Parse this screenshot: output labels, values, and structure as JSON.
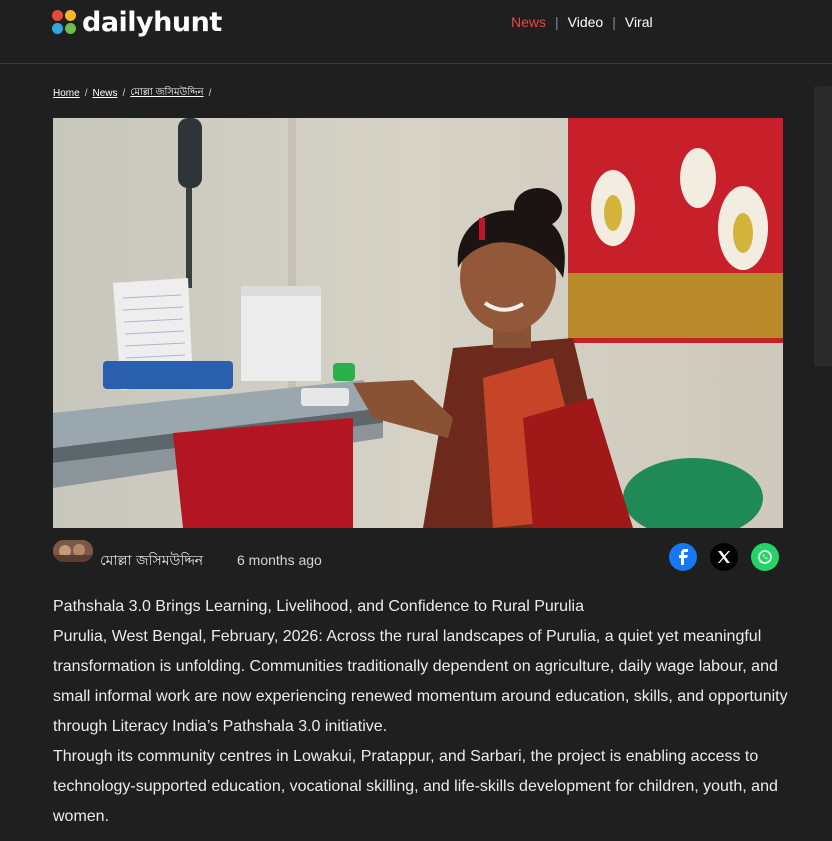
{
  "brand": {
    "name": "dailyhunt"
  },
  "nav": {
    "items": [
      {
        "label": "News",
        "active": true
      },
      {
        "label": "Video",
        "active": false
      },
      {
        "label": "Viral",
        "active": false
      }
    ],
    "separator": "|"
  },
  "breadcrumb": {
    "items": [
      "Home",
      "News",
      "মোল্লা জসিমউদ্দিন"
    ],
    "separator": "/"
  },
  "article": {
    "author": "মোল্লা জসিমউদ্দিন",
    "published": "6 months ago",
    "share": [
      "facebook-icon",
      "x-icon",
      "whatsapp-icon"
    ],
    "paragraphs": [
      "Pathshala 3.0 Brings Learning, Livelihood, and Confidence to Rural Purulia",
      "Purulia, West Bengal, February, 2026: Across the rural landscapes of Purulia, a quiet yet meaningful transformation is unfolding. Communities traditionally dependent on agriculture, daily wage labour, and small informal work are now experiencing renewed momentum around education, skills, and opportunity through Literacy India’s Pathshala 3.0 initiative.",
      "Through its community centres in Lowakui, Pratappur, and Sarbari, the project is enabling access to technology-supported education, vocational skilling, and life-skills development for children, youth, and women."
    ]
  },
  "colors": {
    "background": "#1f1f1f",
    "accent": "#e9483b",
    "facebook": "#1877f2",
    "x": "#000000",
    "whatsapp": "#25d366"
  }
}
